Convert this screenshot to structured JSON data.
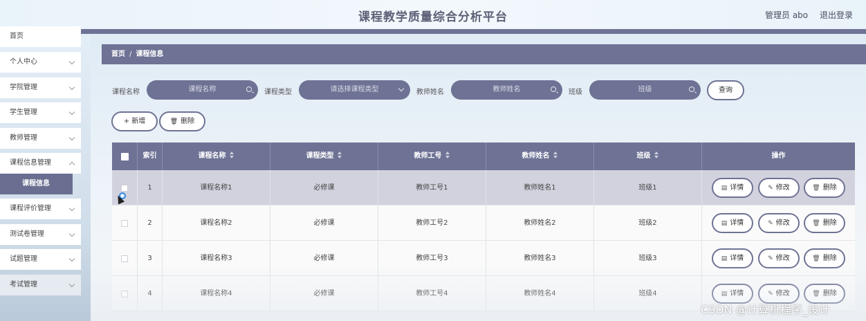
{
  "header": {
    "title": "课程教学质量综合分析平台",
    "admin": "管理员 abo",
    "logout": "退出登录"
  },
  "sidebar": {
    "items": [
      {
        "label": "首页"
      },
      {
        "label": "个人中心"
      },
      {
        "label": "学院管理"
      },
      {
        "label": "学生管理"
      },
      {
        "label": "教师管理"
      },
      {
        "label": "课程信息管理"
      },
      {
        "label": "课程评价管理"
      },
      {
        "label": "测试卷管理"
      },
      {
        "label": "试题管理"
      },
      {
        "label": "考试管理"
      }
    ],
    "sub_active": "课程信息"
  },
  "breadcrumb": {
    "home": "首页",
    "sep": "/",
    "current": "课程信息"
  },
  "search": {
    "course_name_label": "课程名称",
    "course_name_placeholder": "课程名称",
    "course_type_label": "课程类型",
    "course_type_placeholder": "请选择课程类型",
    "teacher_name_label": "教师姓名",
    "teacher_name_placeholder": "教师姓名",
    "class_label": "班级",
    "class_placeholder": "班级",
    "query_button": "查询"
  },
  "actions": {
    "add": "+ 新增",
    "delete": "删除"
  },
  "table": {
    "headers": [
      "索引",
      "课程名称",
      "课程类型",
      "教师工号",
      "教师姓名",
      "班级",
      "操作"
    ],
    "row_actions": {
      "detail": "详情",
      "edit": "修改",
      "delete": "删除"
    },
    "rows": [
      {
        "index": "1",
        "name": "课程名称1",
        "type": "必修课",
        "teacher_no": "教师工号1",
        "teacher_name": "教师姓名1",
        "class": "班级1"
      },
      {
        "index": "2",
        "name": "课程名称2",
        "type": "必修课",
        "teacher_no": "教师工号2",
        "teacher_name": "教师姓名2",
        "class": "班级2"
      },
      {
        "index": "3",
        "name": "课程名称3",
        "type": "必修课",
        "teacher_no": "教师工号3",
        "teacher_name": "教师姓名3",
        "class": "班级3"
      },
      {
        "index": "4",
        "name": "课程名称4",
        "type": "必修课",
        "teacher_no": "教师工号4",
        "teacher_name": "教师姓名4",
        "class": "班级4"
      }
    ]
  },
  "watermark": "CSDN @计算机程序_设计",
  "colors": {
    "accent": "#6e7294",
    "header_bar": "#6f7395",
    "selected_row": "#d1d2dd"
  }
}
